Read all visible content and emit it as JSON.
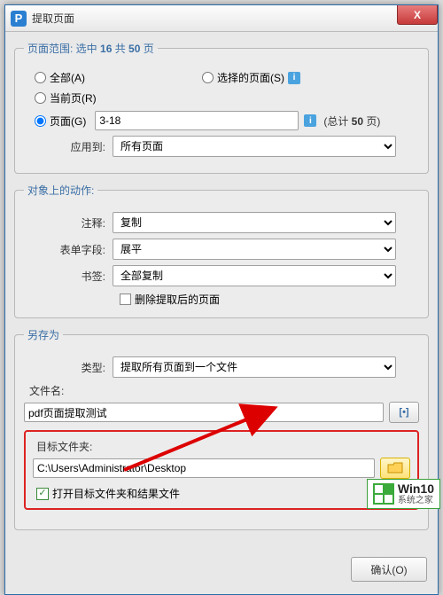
{
  "titlebar": {
    "app_icon_letter": "P",
    "title": "提取页面",
    "close_glyph": "X"
  },
  "page_range": {
    "legend_prefix": "页面范围: 选中 ",
    "selected_count": "16",
    "legend_mid": " 共 ",
    "total_count_inline": "50",
    "legend_suffix": " 页",
    "radio_all": "全部(A)",
    "radio_selected": "选择的页面(S)",
    "radio_current": "当前页(R)",
    "radio_pages": "页面(G)",
    "range_value": "3-18",
    "total_label_prefix": "(总计 ",
    "total_value": "50",
    "total_label_suffix": " 页)",
    "apply_label": "应用到:",
    "apply_value": "所有页面"
  },
  "actions": {
    "legend": "对象上的动作:",
    "annot_label": "注释:",
    "annot_value": "复制",
    "form_label": "表单字段:",
    "form_value": "展平",
    "bookmark_label": "书签:",
    "bookmark_value": "全部复制",
    "delete_label": "删除提取后的页面"
  },
  "save_as": {
    "legend": "另存为",
    "type_label": "类型:",
    "type_value": "提取所有页面到一个文件",
    "filename_label": "文件名:",
    "filename_value": "pdf页面提取测试",
    "options_btn_glyph": "[•]"
  },
  "target": {
    "label": "目标文件夹:",
    "path": "C:\\Users\\Administrator\\Desktop",
    "open_target_label": "打开目标文件夹和结果文件"
  },
  "buttons": {
    "ok": "确认(O)"
  },
  "watermark": {
    "line1": "Win10",
    "line2": "系统之家"
  },
  "info_glyph": "i"
}
